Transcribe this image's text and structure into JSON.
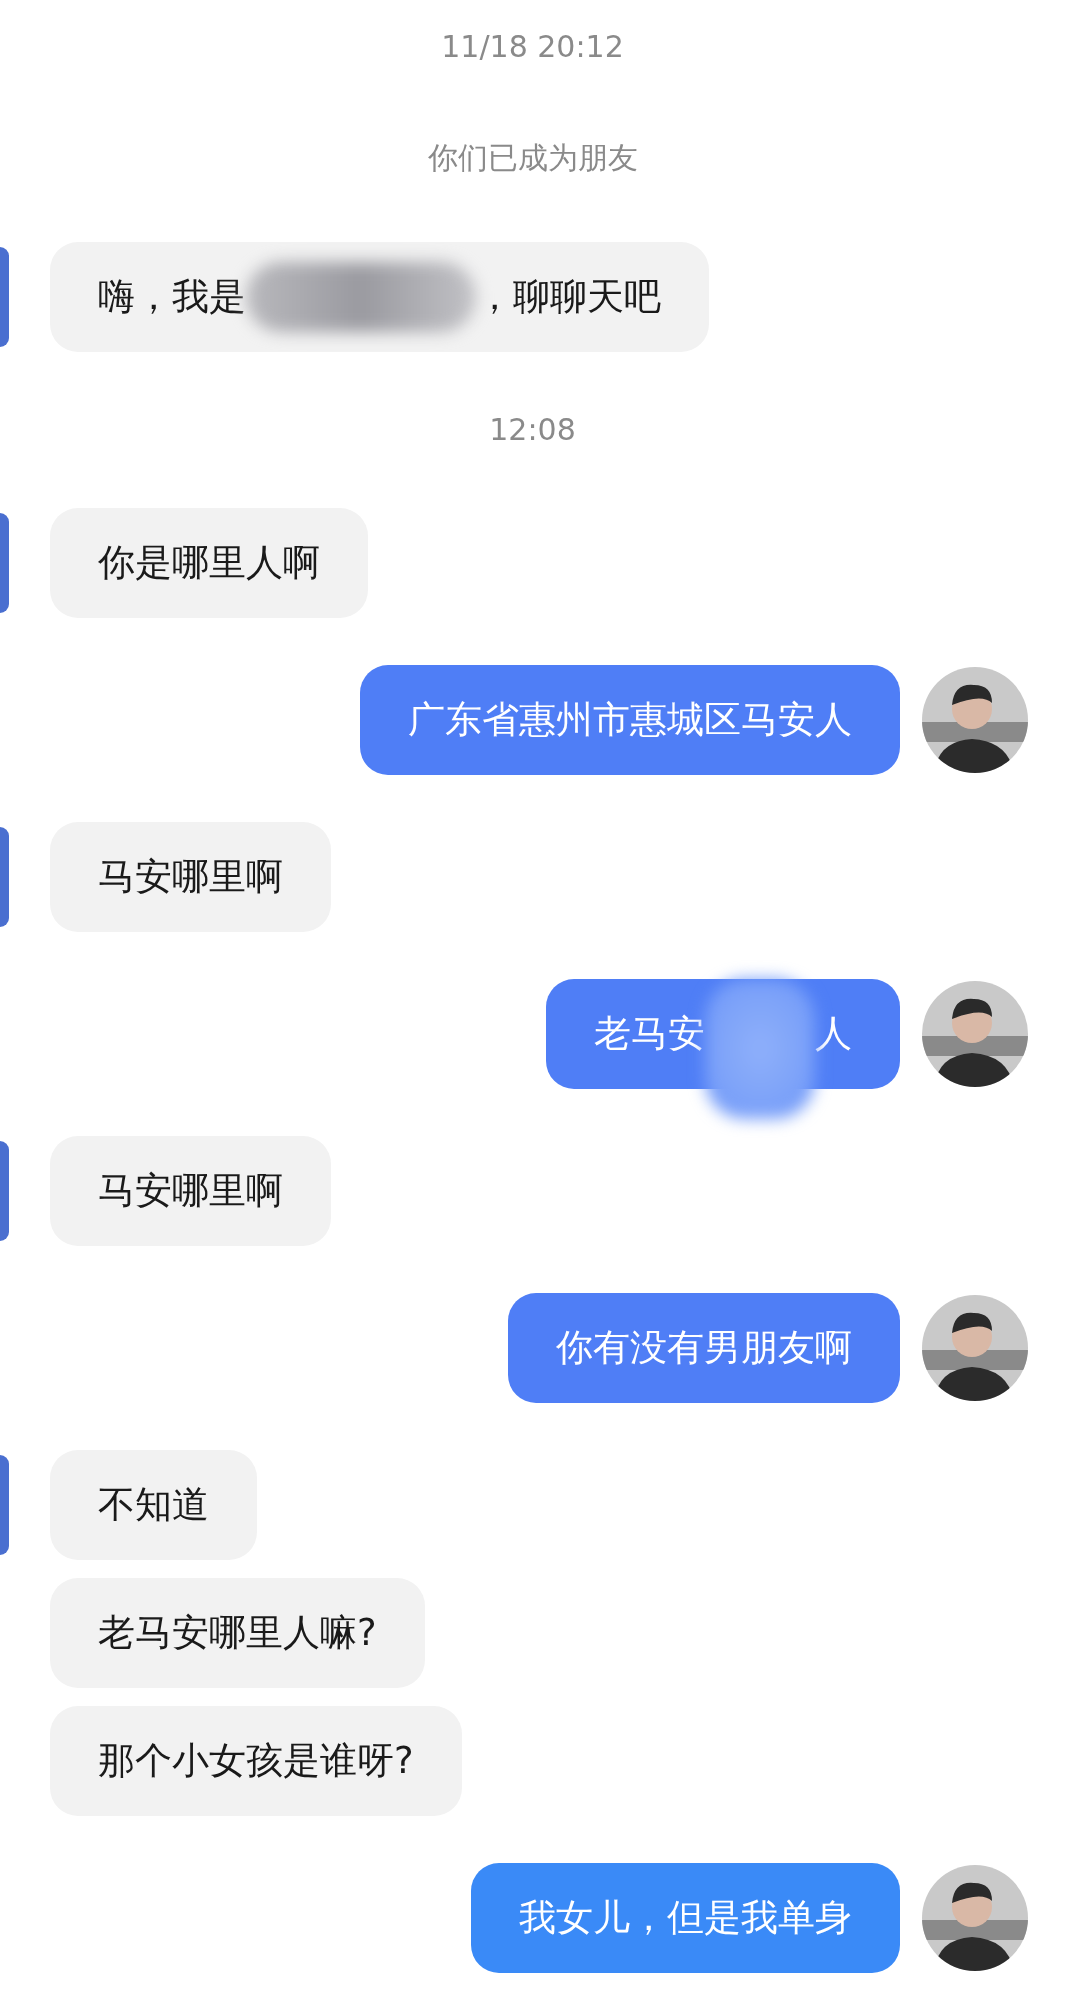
{
  "messages": [
    {
      "kind": "time",
      "text": "11/18 20:12"
    },
    {
      "kind": "system",
      "text": "你们已成为朋友"
    },
    {
      "kind": "in",
      "avatar_visible": true,
      "text": "嗨，我是",
      "redacted": true,
      "text_after": "，聊聊天吧"
    },
    {
      "kind": "time",
      "text": "12:08"
    },
    {
      "kind": "in",
      "avatar_visible": true,
      "text": "你是哪里人啊",
      "redacted": false
    },
    {
      "kind": "out",
      "color": "#4f7ef6",
      "text": "广东省惠州市惠城区马安人",
      "redacted": false
    },
    {
      "kind": "in",
      "avatar_visible": true,
      "text": "马安哪里啊",
      "redacted": false
    },
    {
      "kind": "out",
      "color": "#4f7ef6",
      "text": "老马安",
      "redacted": true,
      "text_after": "人"
    },
    {
      "kind": "in",
      "avatar_visible": true,
      "text": "马安哪里啊",
      "redacted": false
    },
    {
      "kind": "out",
      "color": "#4f7ef6",
      "text": "你有没有男朋友啊",
      "redacted": false
    },
    {
      "kind": "in",
      "avatar_visible": true,
      "text": "不知道",
      "redacted": false
    },
    {
      "kind": "in",
      "avatar_visible": false,
      "text": "老马安哪里人嘛?",
      "redacted": false
    },
    {
      "kind": "in",
      "avatar_visible": false,
      "text": "那个小女孩是谁呀?",
      "redacted": false
    },
    {
      "kind": "out",
      "color": "#3a8af7",
      "text": "我女儿，但是我单身",
      "redacted": false
    }
  ]
}
